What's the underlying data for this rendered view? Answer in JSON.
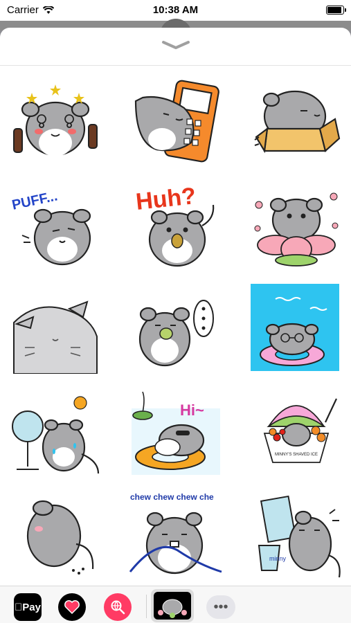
{
  "status_bar": {
    "carrier": "Carrier",
    "time": "10:38 AM",
    "battery_level": 0.85
  },
  "stickers": [
    {
      "name": "dizzy-chinchilla-with-bottles",
      "text": ""
    },
    {
      "name": "chinchilla-with-phone",
      "text": ""
    },
    {
      "name": "chinchilla-in-box",
      "text": ""
    },
    {
      "name": "puff-chinchilla",
      "text": "PUFF..."
    },
    {
      "name": "huh-chinchilla",
      "text": "Huh?"
    },
    {
      "name": "chinchilla-with-flower",
      "text": ""
    },
    {
      "name": "sleepy-big-chinchilla",
      "text": ""
    },
    {
      "name": "chinchilla-ellipsis",
      "text": ""
    },
    {
      "name": "chinchilla-swim-ring",
      "text": ""
    },
    {
      "name": "chinchilla-with-fan",
      "text": ""
    },
    {
      "name": "chinchilla-hi-float",
      "text": "Hi~"
    },
    {
      "name": "chinchilla-shaved-ice",
      "text": "MINNY'S SHAVED ICE"
    },
    {
      "name": "chinchilla-back",
      "text": ""
    },
    {
      "name": "chinchilla-chew",
      "text": "chew chew chew che"
    },
    {
      "name": "chinchilla-mirror-bucket",
      "text": "minny"
    }
  ],
  "drawer": {
    "apple_pay_label": "Pay",
    "more_label": "•••"
  },
  "colors": {
    "body": "#a9a9ab",
    "belly": "#ffffff",
    "outline": "#222222",
    "pink": "#f7a8b8",
    "sky": "#2ec4f0"
  }
}
